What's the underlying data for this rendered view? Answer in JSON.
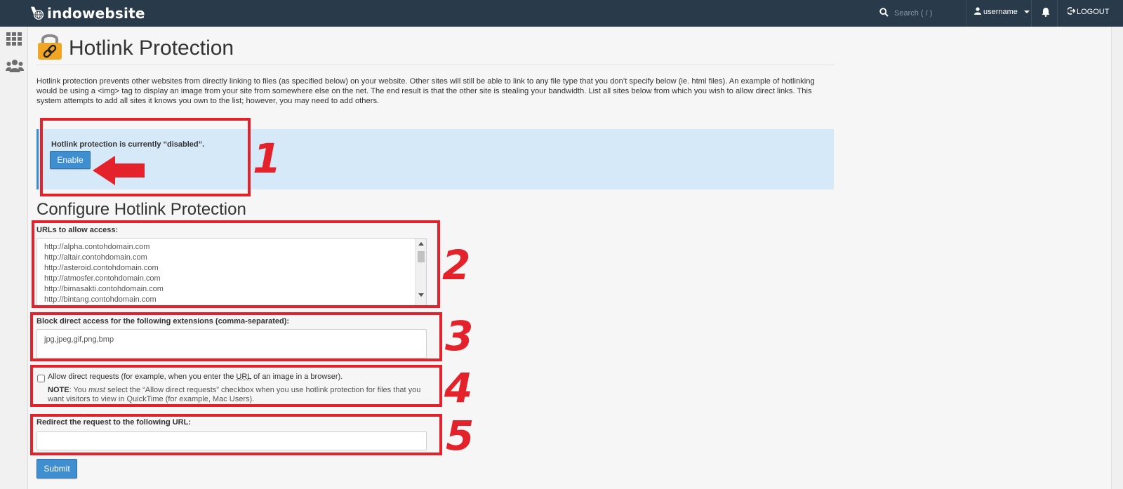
{
  "topbar": {
    "brand": "indowebsite",
    "search_placeholder": "Search ( / )",
    "username": "username",
    "logout_label": "LOGOUT"
  },
  "icons": {
    "logo": "cloud-globe-logo-icon",
    "search": "search-icon",
    "user": "user-icon",
    "bell": "bell-icon",
    "logout": "logout-icon",
    "apps": "grid-icon",
    "users": "users-group-icon",
    "page": "lock-link-icon"
  },
  "page": {
    "title": "Hotlink Protection",
    "description": "Hotlink protection prevents other websites from directly linking to files (as specified below) on your website. Other sites will still be able to link to any file type that you don’t specify below (ie. html files). An example of hotlinking would be using a <img> tag to display an image from your site from somewhere else on the net. The end result is that the other site is stealing your bandwidth. List all sites below from which you wish to allow direct links. This system attempts to add all sites it knows you own to the list; however, you may need to add others."
  },
  "status": {
    "message": "Hotlink protection is currently “disabled”.",
    "enable_label": "Enable"
  },
  "configure": {
    "title": "Configure Hotlink Protection",
    "urls_label": "URLs to allow access:",
    "urls": [
      "http://alpha.contohdomain.com",
      "http://altair.contohdomain.com",
      "http://asteroid.contohdomain.com",
      "http://atmosfer.contohdomain.com",
      "http://bimasakti.contohdomain.com",
      "http://bintang.contohdomain.com"
    ],
    "extensions_label": "Block direct access for the following extensions (comma-separated):",
    "extensions_value": "jpg,jpeg,gif,png,bmp",
    "allow_direct": {
      "label_pre": "Allow direct requests (for example, when you enter the ",
      "label_abbr": "URL",
      "label_post": " of an image in a browser).",
      "checked": false
    },
    "note": {
      "prefix": "NOTE",
      "part1": ": You ",
      "emphasis": "must",
      "part2": " select the “Allow direct requests” checkbox when you use hotlink protection for files that you want visitors to view in QuickTime (for example, Mac Users)."
    },
    "redirect_label": "Redirect the request to the following URL:",
    "redirect_value": "",
    "submit_label": "Submit"
  },
  "annotations": {
    "color": "#e3222c",
    "numbers": [
      "1",
      "2",
      "3",
      "4",
      "5"
    ]
  }
}
